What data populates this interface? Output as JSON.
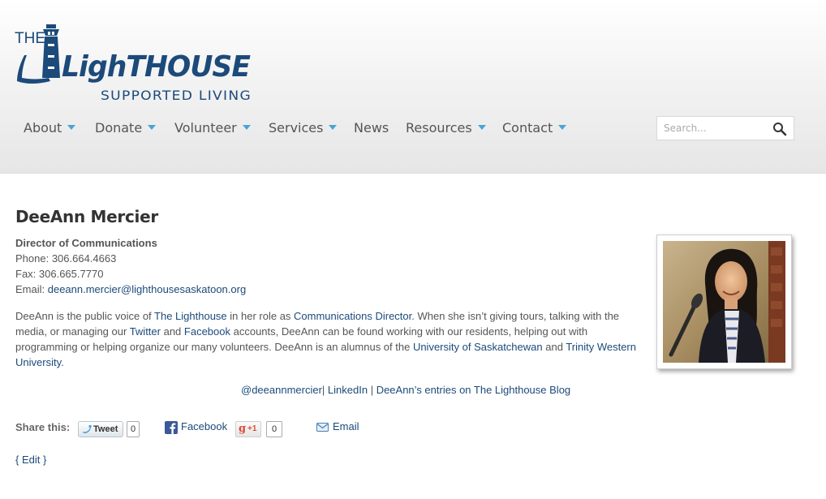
{
  "brand": {
    "logo_the": "THE",
    "logo_main": "LighTHOUSE",
    "logo_sub": "SUPPORTED LIVING",
    "color_primary": "#1c4a7a",
    "color_accent": "#4ba3d4"
  },
  "nav": {
    "items": [
      {
        "label": "About",
        "has_dropdown": true
      },
      {
        "label": "Donate",
        "has_dropdown": true
      },
      {
        "label": "Volunteer",
        "has_dropdown": true
      },
      {
        "label": "Services",
        "has_dropdown": true
      },
      {
        "label": "News",
        "has_dropdown": false
      },
      {
        "label": "Resources",
        "has_dropdown": true
      },
      {
        "label": "Contact",
        "has_dropdown": true
      }
    ]
  },
  "search": {
    "placeholder": "Search...",
    "icon": "magnifier-icon"
  },
  "profile": {
    "name": "DeeAnn Mercier",
    "role": "Director of Communications",
    "phone": "Phone: 306.664.4663",
    "fax": "Fax: 306.665.7770",
    "email_label": "Email: ",
    "email": "deeann.mercier@lighthousesaskatoon.org",
    "photo_icon": "profile-photo"
  },
  "bio": {
    "t1": "DeeAnn is the public voice of ",
    "l1": "The Lighthouse",
    "t2": " in her role as ",
    "l2": "Communications Director",
    "t3": ". When she isn’t giving tours, talking with the media, or managing our ",
    "l3": "Twitter",
    "t4": " and ",
    "l4": "Facebook",
    "t5": " accounts, DeeAnn can be found working with our residents, helping out with programming or helping organize our many volunteers. DeeAnn is an alumnus of the ",
    "l5": "University of Saskatchewan",
    "t6": " and ",
    "l6": "Trinity Western University",
    "t7": "."
  },
  "social": {
    "twitter": "@deeannmercier",
    "sep1": "| ",
    "linkedin": "LinkedIn",
    "sep2": " | ",
    "blog": "DeeAnn’s entries on The Lighthouse Blog"
  },
  "share": {
    "label": "Share this:",
    "tweet_label": "Tweet",
    "tweet_count": "0",
    "facebook_label": "Facebook",
    "gplus_label": "+1",
    "gplus_count": "0",
    "email_label": "Email"
  },
  "edit": {
    "label": "{ Edit }"
  }
}
